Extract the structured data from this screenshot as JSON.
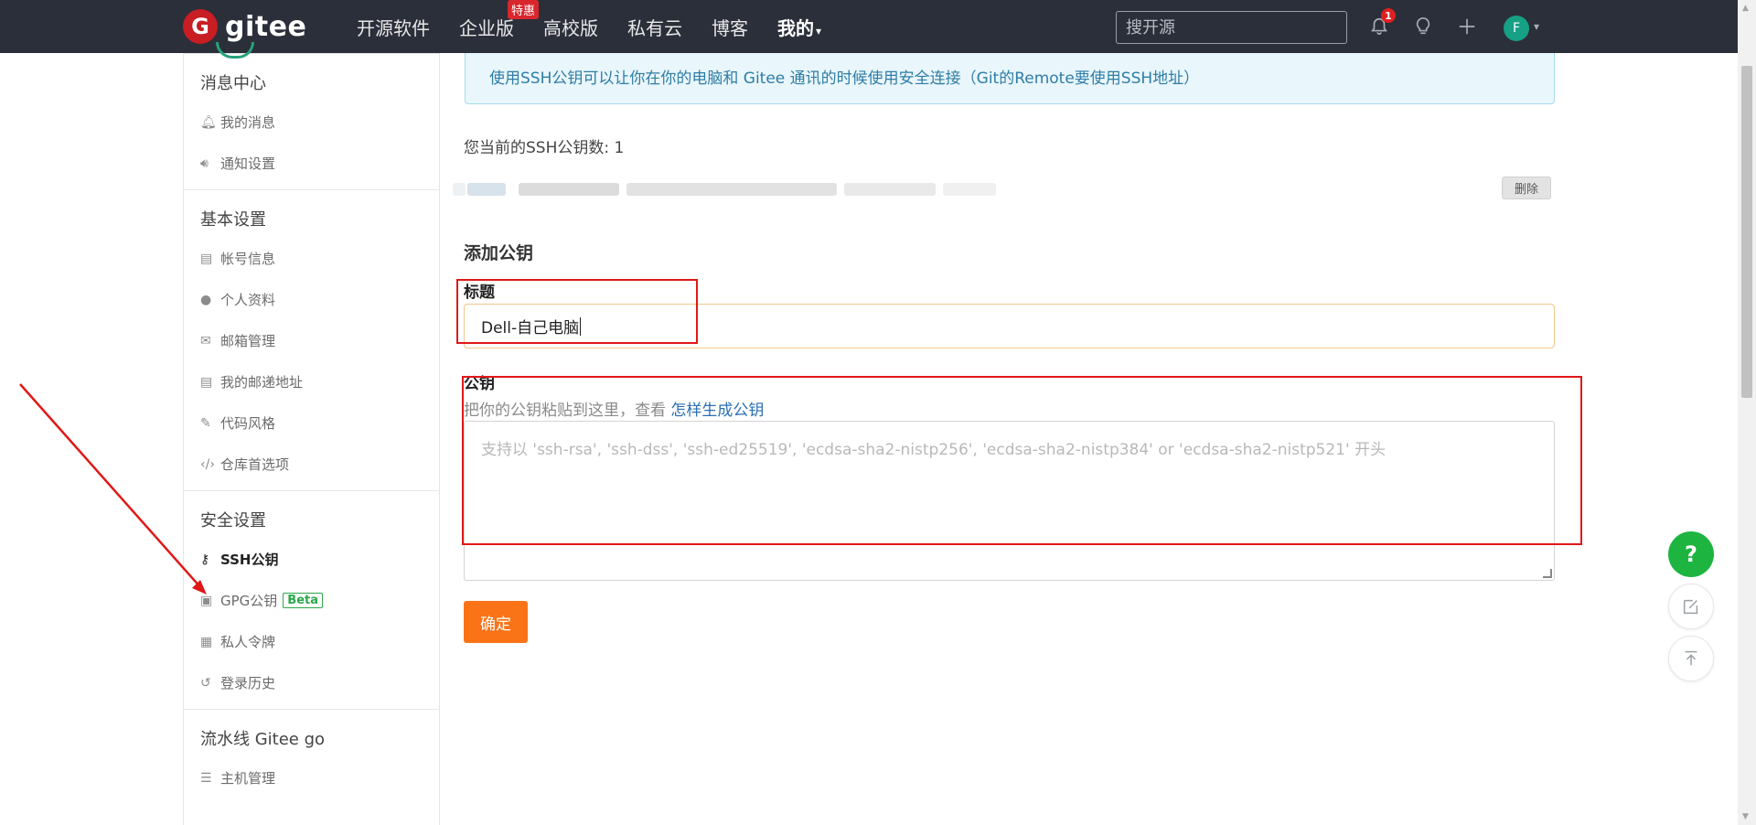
{
  "header": {
    "logo_letter": "G",
    "logo_text": "gitee",
    "nav": [
      "开源软件",
      "企业版",
      "高校版",
      "私有云",
      "博客",
      "我的"
    ],
    "nav_badge": "特惠",
    "search_placeholder": "搜开源",
    "notification_count": "1",
    "avatar_letter": "F"
  },
  "sidebar": {
    "groups": [
      {
        "title": "消息中心",
        "items": [
          "我的消息",
          "通知设置"
        ]
      },
      {
        "title": "基本设置",
        "items": [
          "帐号信息",
          "个人资料",
          "邮箱管理",
          "我的邮递地址",
          "代码风格",
          "仓库首选项"
        ]
      },
      {
        "title": "安全设置",
        "items": [
          "SSH公钥",
          "GPG公钥",
          "私人令牌",
          "登录历史"
        ]
      },
      {
        "title": "流水线 Gitee go",
        "items": [
          "主机管理"
        ]
      }
    ],
    "beta_label": "Beta",
    "active_item": "SSH公钥"
  },
  "main": {
    "info_text": "使用SSH公钥可以让你在你的电脑和 Gitee 通讯的时候使用安全连接（Git的Remote要使用SSH地址）",
    "key_count_text": "您当前的SSH公钥数: 1",
    "delete_label": "删除",
    "add_key_heading": "添加公钥",
    "title_label": "标题",
    "title_value": "Dell-自己电脑",
    "key_label": "公钥",
    "key_hint": "把你的公钥粘贴到这里，查看",
    "key_hint_link": "怎样生成公钥",
    "key_placeholder": "支持以 'ssh-rsa', 'ssh-dss', 'ssh-ed25519', 'ecdsa-sha2-nistp256', 'ecdsa-sha2-nistp384' or 'ecdsa-sha2-nistp521' 开头",
    "submit_label": "确定"
  },
  "floating": {
    "help": "?"
  },
  "colors": {
    "header_bg": "#2b2f3a",
    "brand_red": "#c71d23",
    "accent_orange": "#fb7317",
    "help_green": "#1db440"
  }
}
